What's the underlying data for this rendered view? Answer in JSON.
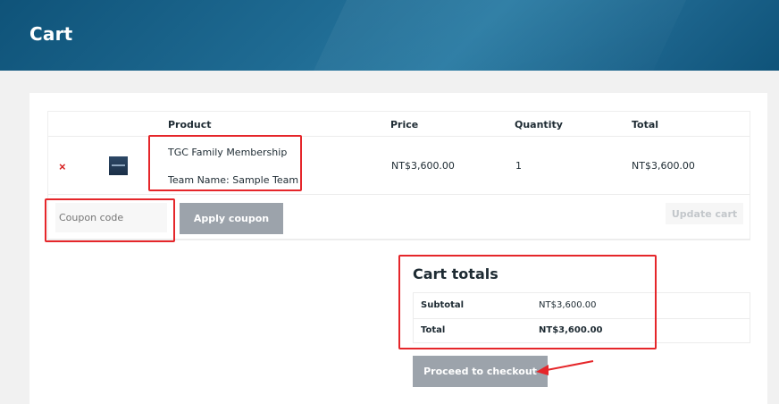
{
  "banner": {
    "title": "Cart"
  },
  "cart_table": {
    "headers": {
      "product": "Product",
      "price": "Price",
      "quantity": "Quantity",
      "total": "Total"
    },
    "rows": [
      {
        "remove": "×",
        "product_name": "TGC Family Membership",
        "product_meta": "Team Name: Sample Team",
        "price": "NT$3,600.00",
        "quantity": "1",
        "total": "NT$3,600.00"
      }
    ]
  },
  "coupon": {
    "placeholder": "Coupon code",
    "value": ""
  },
  "buttons": {
    "apply_coupon": "Apply coupon",
    "update_cart": "Update cart",
    "proceed_to_checkout": "Proceed to checkout"
  },
  "cart_totals": {
    "title": "Cart totals",
    "subtotal_label": "Subtotal",
    "subtotal_value": "NT$3,600.00",
    "total_label": "Total",
    "total_value": "NT$3,600.00"
  },
  "colors": {
    "banner": "#0f5379",
    "annotation": "#e5262a",
    "button": "#9ca3ab",
    "remove": "#d71f1f"
  },
  "icons": {
    "remove": "close-icon",
    "product_thumbnail": "product-thumbnail",
    "arrow": "arrow-annotation"
  }
}
